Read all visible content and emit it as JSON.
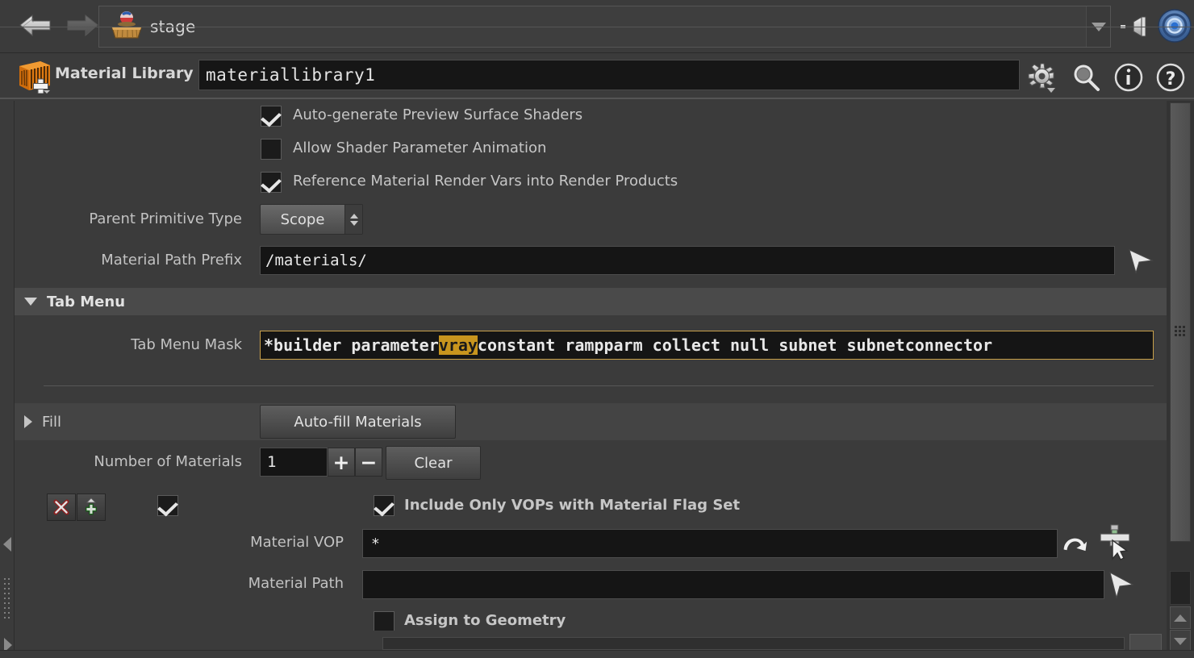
{
  "pathbar": {
    "back_icon": "back-arrow-icon",
    "forward_icon": "forward-arrow-icon",
    "stage_icon": "stage-node-icon",
    "path_value": "stage",
    "dropdown_icon": "chevron-down-icon",
    "pin_icon": "pin-icon",
    "target_icon": "target-icon"
  },
  "nodebar": {
    "type_icon": "material-library-node-icon",
    "type_label": "Material Library",
    "name_value": "materiallibrary1",
    "gear_icon": "gear-icon",
    "search_icon": "search-icon",
    "info_icon": "info-icon",
    "help_icon": "help-icon"
  },
  "params": {
    "auto_generate_preview": {
      "label": "Auto-generate Preview Surface Shaders",
      "checked": true
    },
    "allow_shader_anim": {
      "label": "Allow Shader Parameter Animation",
      "checked": false
    },
    "reference_render_vars": {
      "label": "Reference Material Render Vars into Render Products",
      "checked": true
    },
    "parent_primitive_type": {
      "label": "Parent Primitive Type",
      "value": "Scope"
    },
    "material_path_prefix": {
      "label": "Material Path Prefix",
      "value": "/materials/",
      "op_icon": "op-chooser-arrow-icon"
    }
  },
  "tab_menu": {
    "section_title": "Tab Menu",
    "mask_label": "Tab Menu Mask",
    "mask_prefix": "*builder parameter ",
    "mask_highlight": "vray",
    "mask_suffix": " constant rampparm collect null subnet subnetconnector",
    "mask_full": "*builder parameter vray constant rampparm collect null subnet subnetconnector"
  },
  "fill": {
    "section_title": "Fill",
    "autofill_button": "Auto-fill Materials",
    "number_label": "Number of Materials",
    "number_value": "1",
    "plus_label": "+",
    "minus_label": "−",
    "clear_button": "Clear",
    "remove_icon": "delete-multiparm-icon",
    "add_icon": "insert-multiparm-icon",
    "enable_toggle": {
      "checked": true
    },
    "include_only_vops": {
      "label": "Include Only VOPs with Material Flag Set",
      "checked": true
    },
    "material_vop": {
      "label": "Material VOP",
      "value": "*",
      "reload_icon": "reload-icon",
      "pick_icon": "node-picker-icon"
    },
    "material_path": {
      "label": "Material Path",
      "value": "",
      "pick_icon": "path-picker-arrow-icon"
    },
    "assign_to_geometry": {
      "label": "Assign to Geometry",
      "checked": false
    }
  },
  "scrollbar": {
    "up_icon": "scroll-up-icon",
    "down_icon": "scroll-down-icon",
    "grip_icon": "scroll-grip-icon"
  },
  "colors": {
    "background": "#3b3b3b",
    "field_bg": "#151515",
    "highlight": "#c8951e",
    "focus_border": "#c9a14a",
    "section_header": "#4a4a4a"
  }
}
